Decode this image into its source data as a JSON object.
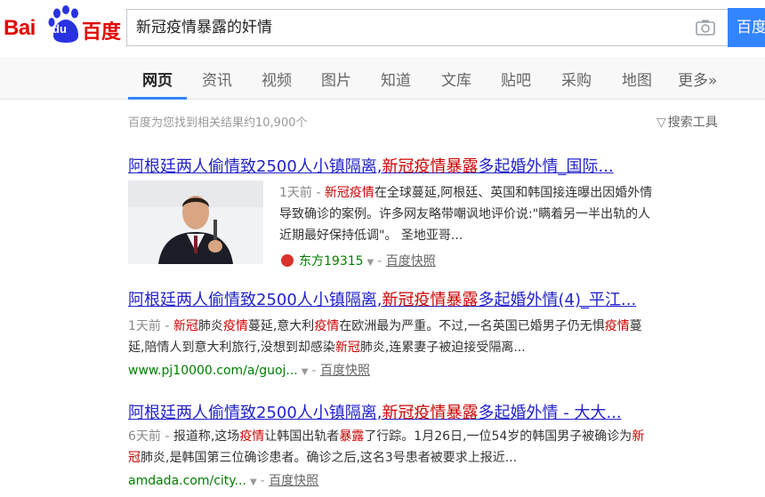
{
  "logo": {
    "bai": "Bai",
    "du": "du",
    "baidu": "百度"
  },
  "search": {
    "query": "新冠疫情暴露的奸情",
    "button_label": "百度一下"
  },
  "nav": {
    "tabs": [
      "网页",
      "资讯",
      "视频",
      "图片",
      "知道",
      "文库",
      "贴吧",
      "采购",
      "地图",
      "更多»"
    ],
    "active_index": 0
  },
  "result_count": "百度为您找到相关结果约10,900个",
  "tools_label": "搜索工具",
  "results": [
    {
      "title_plain": "阿根廷两人偷情致2500人小镇隔离,",
      "title_hl": "新冠疫情暴露",
      "title_tail": "多起婚外情_国际...",
      "snippet": {
        "date": "1天前 - ",
        "line1_hl": "新冠疫情",
        "line1_tail": "在全球蔓延,阿根廷、英国和韩国接连曝出因婚外情",
        "line2": "导致确诊的案例。许多网友略带嘲讽地评价说:\"瞒着另一半出轨的人",
        "line3": "近期最好保持低调\"。 圣地亚哥..."
      },
      "source": "东方19315",
      "snapshot": "百度快照"
    },
    {
      "title_plain": "阿根廷两人偷情致2500人小镇隔离,",
      "title_hl": "新冠疫情暴露",
      "title_tail": "多起婚外情(4)_平江...",
      "snippet": {
        "date": "1天前 - ",
        "p1_hl": "新冠",
        "p1": "肺炎",
        "p1_hl2": "疫情",
        "p1_b": "蔓延,意大利",
        "p1_hl3": "疫情",
        "p1_c": "在欧洲最为严重。不过,一名英国已婚男子仍无惧",
        "p1_hl4": "疫情",
        "p1_d": "蔓",
        "l2_a": "延,陪情人到意大利旅行,没想到却感染",
        "l2_hl": "新冠",
        "l2_b": "肺炎,连累妻子被迫接受隔离..."
      },
      "url": "www.pj10000.com/a/guoj...",
      "snapshot": "百度快照"
    },
    {
      "title_plain": "阿根廷两人偷情致2500人小镇隔离,",
      "title_hl": "新冠疫情暴露",
      "title_tail": "多起婚外情 - 大大...",
      "snippet": {
        "date": "6天前 - ",
        "l1_a": "报道称,这场",
        "l1_hl": "疫情",
        "l1_b": "让韩国出轨者",
        "l1_hl2": "暴露",
        "l1_c": "了行踪。1月26日,一位54岁的韩国男子被确诊为",
        "l1_hl3": "新",
        "l2_hl": "冠",
        "l2_a": "肺炎,是韩国第三位确诊患者。确诊之后,这名3号患者被要求上报近..."
      },
      "url": "amdada.com/city...",
      "snapshot": "百度快照"
    }
  ],
  "colors": {
    "accent": "#3385ff",
    "link": "#2222cc",
    "highlight": "#cc0000",
    "url": "#008000",
    "brand": "#e10602"
  }
}
